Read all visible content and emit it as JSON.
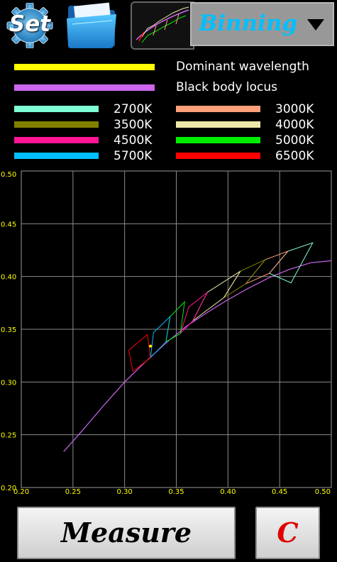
{
  "toolbar": {
    "set_label": "Set",
    "mode_select": {
      "value": "Binning"
    }
  },
  "legend": {
    "lines": [
      {
        "label": "Dominant wavelength",
        "color": "#ffff00"
      },
      {
        "label": "Black body locus",
        "color": "#cc66ee"
      }
    ],
    "cct": [
      {
        "label": "2700K",
        "color": "#7fffd4"
      },
      {
        "label": "3000K",
        "color": "#ffa07a"
      },
      {
        "label": "3500K",
        "color": "#808000"
      },
      {
        "label": "4000K",
        "color": "#eee8aa"
      },
      {
        "label": "4500K",
        "color": "#ff1493"
      },
      {
        "label": "5000K",
        "color": "#00ee00"
      },
      {
        "label": "5700K",
        "color": "#00bfff"
      },
      {
        "label": "6500K",
        "color": "#ff0000"
      }
    ]
  },
  "chart_data": {
    "type": "scatter",
    "xlim": [
      0.2,
      0.5
    ],
    "ylim": [
      0.2,
      0.5
    ],
    "xticks": [
      "0.20",
      "0.25",
      "0.30",
      "0.35",
      "0.40",
      "0.45",
      "0.50"
    ],
    "yticks": [
      "0.20",
      "0.25",
      "0.30",
      "0.35",
      "0.40",
      "0.45",
      "0.50"
    ],
    "grid": true,
    "tick_color": "#ffff00",
    "series": [
      {
        "name": "Black body locus",
        "color": "#cc66ee",
        "points": [
          [
            0.241,
            0.234
          ],
          [
            0.26,
            0.255
          ],
          [
            0.28,
            0.278
          ],
          [
            0.3,
            0.3
          ],
          [
            0.32,
            0.319
          ],
          [
            0.34,
            0.337
          ],
          [
            0.36,
            0.353
          ],
          [
            0.38,
            0.366
          ],
          [
            0.4,
            0.378
          ],
          [
            0.42,
            0.389
          ],
          [
            0.44,
            0.399
          ],
          [
            0.46,
            0.407
          ],
          [
            0.48,
            0.413
          ],
          [
            0.5,
            0.415
          ]
        ]
      }
    ],
    "bins": [
      {
        "cct": "2700K",
        "color": "#7fffd4",
        "quad": [
          [
            0.44,
            0.403
          ],
          [
            0.458,
            0.424
          ],
          [
            0.482,
            0.432
          ],
          [
            0.461,
            0.394
          ]
        ]
      },
      {
        "cct": "3000K",
        "color": "#ffa07a",
        "quad": [
          [
            0.417,
            0.393
          ],
          [
            0.436,
            0.416
          ],
          [
            0.458,
            0.424
          ],
          [
            0.44,
            0.403
          ]
        ]
      },
      {
        "cct": "3500K",
        "color": "#808000",
        "quad": [
          [
            0.396,
            0.38
          ],
          [
            0.412,
            0.405
          ],
          [
            0.436,
            0.416
          ],
          [
            0.417,
            0.393
          ]
        ]
      },
      {
        "cct": "4000K",
        "color": "#eee8aa",
        "quad": [
          [
            0.366,
            0.358
          ],
          [
            0.38,
            0.385
          ],
          [
            0.412,
            0.405
          ],
          [
            0.396,
            0.38
          ]
        ]
      },
      {
        "cct": "4500K",
        "color": "#ff1493",
        "quad": [
          [
            0.354,
            0.346
          ],
          [
            0.362,
            0.371
          ],
          [
            0.38,
            0.385
          ],
          [
            0.366,
            0.358
          ]
        ]
      },
      {
        "cct": "5000K",
        "color": "#00ee00",
        "quad": [
          [
            0.34,
            0.338
          ],
          [
            0.344,
            0.362
          ],
          [
            0.358,
            0.376
          ],
          [
            0.354,
            0.346
          ]
        ]
      },
      {
        "cct": "5700K",
        "color": "#00bfff",
        "quad": [
          [
            0.325,
            0.323
          ],
          [
            0.328,
            0.347
          ],
          [
            0.344,
            0.362
          ],
          [
            0.34,
            0.338
          ]
        ]
      },
      {
        "cct": "6500K",
        "color": "#ff0000",
        "quad": [
          [
            0.308,
            0.31
          ],
          [
            0.304,
            0.33
          ],
          [
            0.322,
            0.345
          ],
          [
            0.325,
            0.323
          ]
        ]
      }
    ],
    "point": {
      "x": 0.325,
      "y": 0.334,
      "color": "#ffff00"
    }
  },
  "buttons": {
    "measure_label": "Measure",
    "clear_label": "C"
  }
}
